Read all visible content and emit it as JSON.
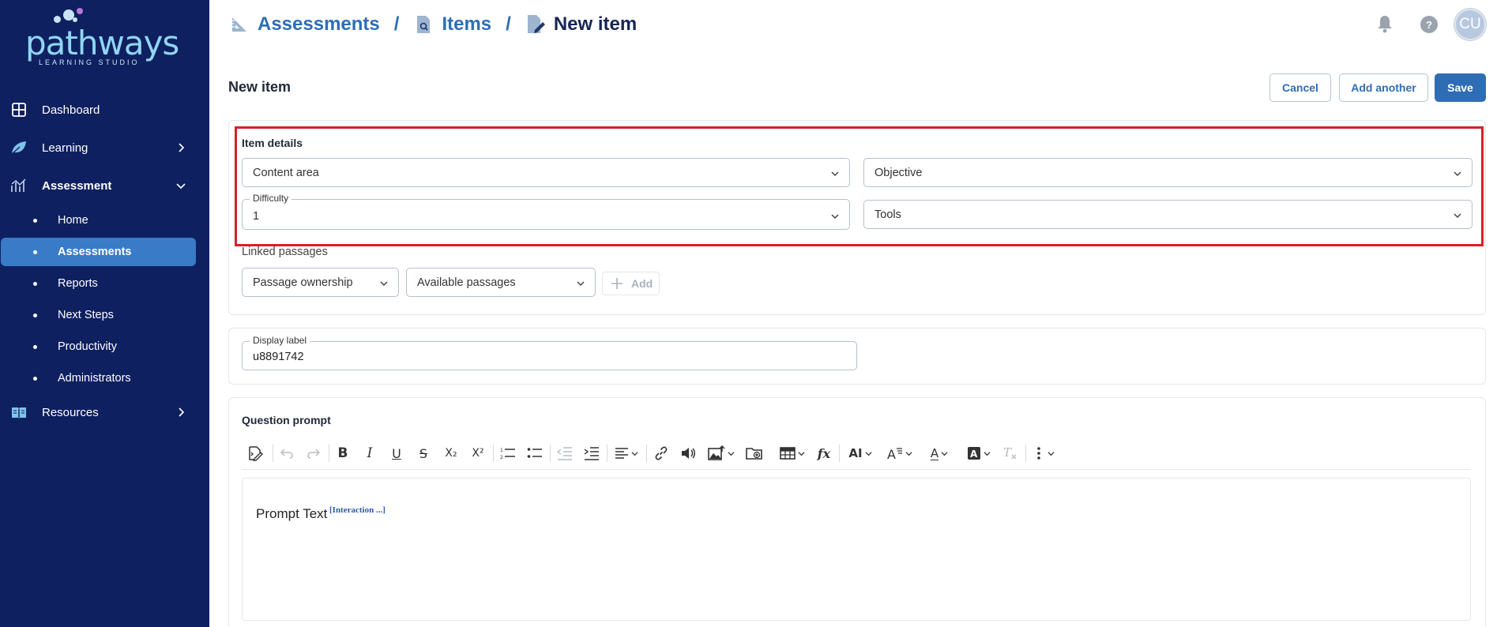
{
  "app": {
    "logo_word": "pathways",
    "logo_sub": "LEARNING STUDIO",
    "colors": {
      "sidebar": "#0f2060",
      "accent": "#2e6db4",
      "highlight": "#d81f26"
    }
  },
  "sidebar": {
    "items": [
      {
        "label": "Dashboard",
        "icon": "dashboard-grid-icon"
      },
      {
        "label": "Learning",
        "icon": "leaf-icon",
        "chevron": "right"
      },
      {
        "label": "Assessment",
        "icon": "chart-icon",
        "chevron": "down",
        "expanded": true
      },
      {
        "label": "Resources",
        "icon": "book-icon",
        "chevron": "right"
      }
    ],
    "sub_items": [
      {
        "label": "Home"
      },
      {
        "label": "Assessments",
        "active": true
      },
      {
        "label": "Reports"
      },
      {
        "label": "Next Steps"
      },
      {
        "label": "Productivity"
      },
      {
        "label": "Administrators"
      }
    ]
  },
  "breadcrumb": {
    "items": [
      {
        "label": "Assessments",
        "icon": "ruler-triangle-icon"
      },
      {
        "label": "Items",
        "icon": "file-search-icon"
      },
      {
        "label": "New item",
        "icon": "file-edit-icon"
      }
    ],
    "separator": "/"
  },
  "header": {
    "avatar_initials": "CU",
    "help_glyph": "?"
  },
  "page": {
    "title": "New item",
    "buttons": {
      "cancel": "Cancel",
      "add_another": "Add another",
      "save": "Save"
    }
  },
  "item_details": {
    "title": "Item details",
    "content_area": {
      "placeholder": "Content area"
    },
    "objective": {
      "placeholder": "Objective"
    },
    "difficulty": {
      "label": "Difficulty",
      "value": "1"
    },
    "tools": {
      "placeholder": "Tools"
    }
  },
  "linked_passages": {
    "label": "Linked passages",
    "ownership": "Passage ownership",
    "available": "Available passages",
    "add": "Add"
  },
  "display_label": {
    "label": "Display label",
    "value": "u8891742"
  },
  "question_prompt": {
    "title": "Question prompt",
    "toolbar": {
      "bold": "B",
      "italic": "I",
      "underline": "U",
      "strike": "S",
      "subscript": "X₂",
      "superscript": "X²",
      "function": "fx",
      "text_size": "AI",
      "font_color": "A"
    },
    "content": "Prompt Text",
    "interaction": "[Interaction ...]"
  }
}
